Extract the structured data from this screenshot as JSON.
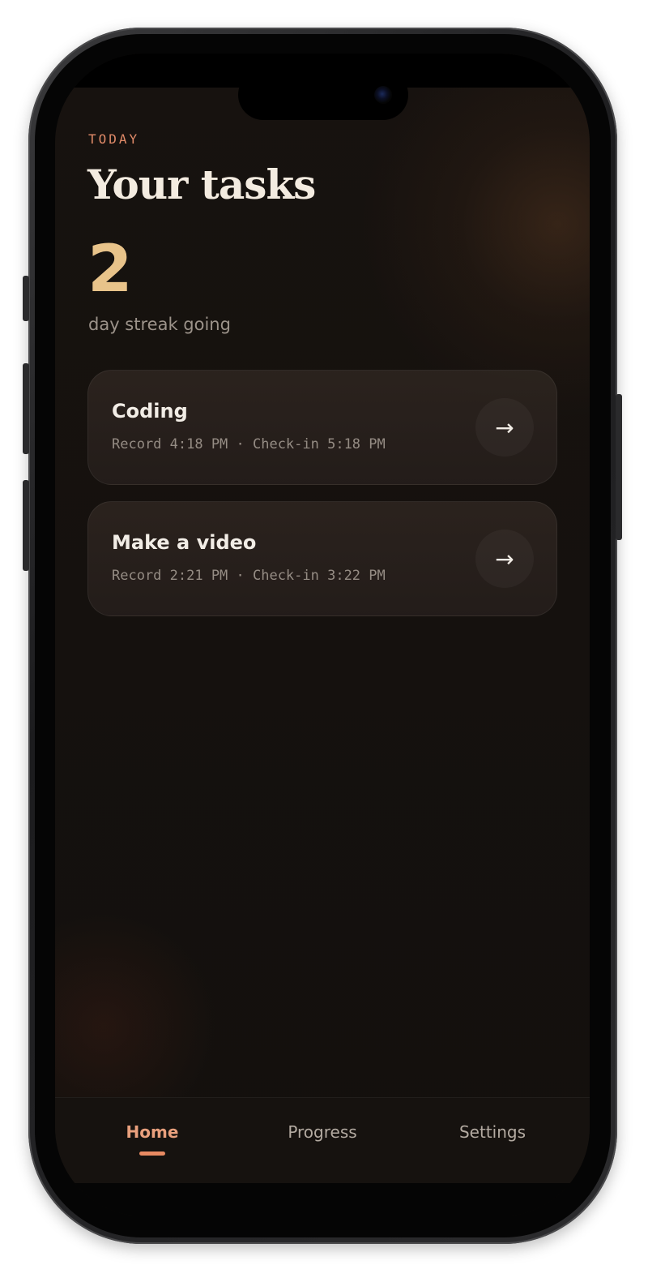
{
  "header": {
    "kicker": "TODAY",
    "title": "Your tasks"
  },
  "streak": {
    "count": "2",
    "label": "day streak going"
  },
  "tasks": [
    {
      "name": "Coding",
      "meta": "Record 4:18 PM · Check-in 5:18 PM",
      "action_icon": "arrow-right-icon"
    },
    {
      "name": "Make a video",
      "meta": "Record 2:21 PM · Check-in 3:22 PM",
      "action_icon": "arrow-right-icon"
    }
  ],
  "tabs": [
    {
      "label": "Home",
      "active": true
    },
    {
      "label": "Progress",
      "active": false
    },
    {
      "label": "Settings",
      "active": false
    }
  ],
  "colors": {
    "accent": "#e88a62",
    "streak": "#e8c38a",
    "background": "#15110e",
    "card": "#2a221e"
  }
}
